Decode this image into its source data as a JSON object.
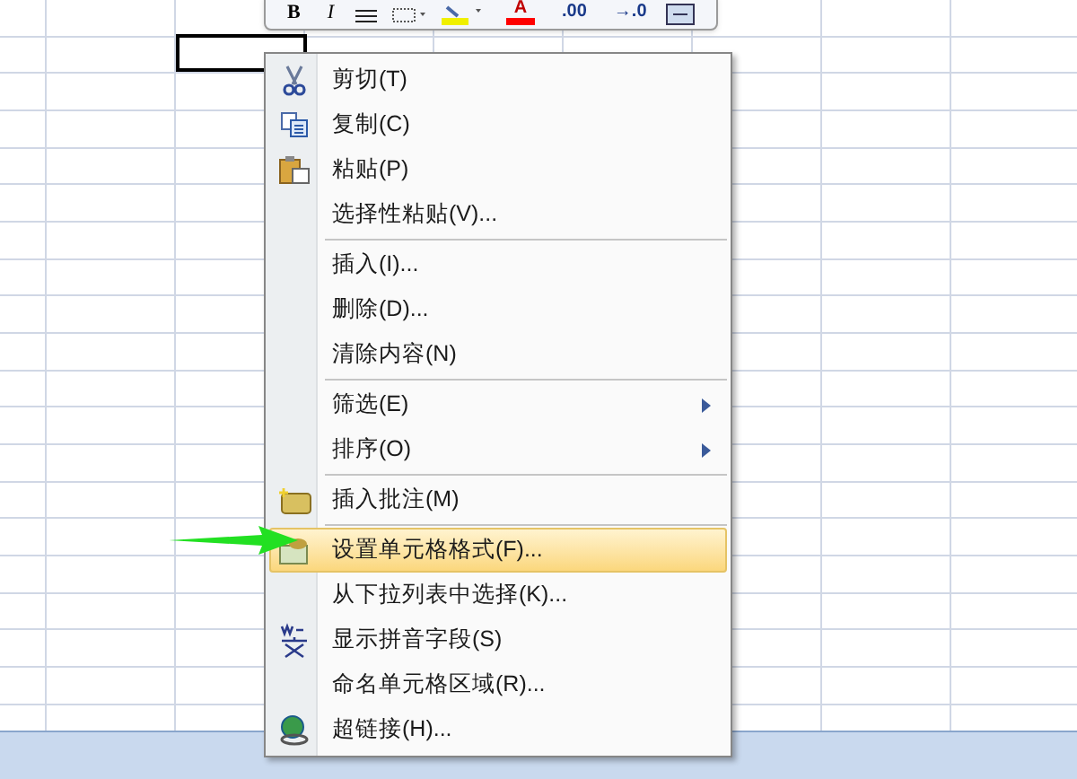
{
  "toolbar": {
    "buttons": [
      {
        "kind": "bold",
        "label": "B"
      },
      {
        "kind": "italic",
        "label": "I"
      },
      {
        "kind": "align"
      },
      {
        "kind": "border"
      },
      {
        "kind": "fill"
      },
      {
        "kind": "fontcolor",
        "label": "A"
      },
      {
        "kind": "decimal",
        "label": ".00"
      },
      {
        "kind": "decimal",
        "label": "→.0"
      },
      {
        "kind": "merge"
      }
    ]
  },
  "context_menu": {
    "items": [
      {
        "kind": "cut",
        "label": "剪切(T)",
        "separator_before": false,
        "submenu": false,
        "selected": false
      },
      {
        "kind": "copy",
        "label": "复制(C)",
        "separator_before": false,
        "submenu": false,
        "selected": false
      },
      {
        "kind": "paste",
        "label": "粘贴(P)",
        "separator_before": false,
        "submenu": false,
        "selected": false
      },
      {
        "kind": "plain",
        "label": "选择性粘贴(V)...",
        "separator_before": false,
        "submenu": false,
        "selected": false
      },
      {
        "kind": "plain",
        "label": "插入(I)...",
        "separator_before": true,
        "submenu": false,
        "selected": false
      },
      {
        "kind": "plain",
        "label": "删除(D)...",
        "separator_before": false,
        "submenu": false,
        "selected": false
      },
      {
        "kind": "plain",
        "label": "清除内容(N)",
        "separator_before": false,
        "submenu": false,
        "selected": false
      },
      {
        "kind": "plain",
        "label": "筛选(E)",
        "separator_before": true,
        "submenu": true,
        "selected": false
      },
      {
        "kind": "plain",
        "label": "排序(O)",
        "separator_before": false,
        "submenu": true,
        "selected": false
      },
      {
        "kind": "comment",
        "label": "插入批注(M)",
        "separator_before": true,
        "submenu": false,
        "selected": false
      },
      {
        "kind": "format",
        "label": "设置单元格格式(F)...",
        "separator_before": true,
        "submenu": false,
        "selected": true
      },
      {
        "kind": "plain",
        "label": "从下拉列表中选择(K)...",
        "separator_before": false,
        "submenu": false,
        "selected": false
      },
      {
        "kind": "phonetic",
        "label": "显示拼音字段(S)",
        "separator_before": false,
        "submenu": false,
        "selected": false
      },
      {
        "kind": "plain",
        "label": "命名单元格区域(R)...",
        "separator_before": false,
        "submenu": false,
        "selected": false
      },
      {
        "kind": "hyperlink",
        "label": "超链接(H)...",
        "separator_before": false,
        "submenu": false,
        "selected": false
      }
    ]
  }
}
